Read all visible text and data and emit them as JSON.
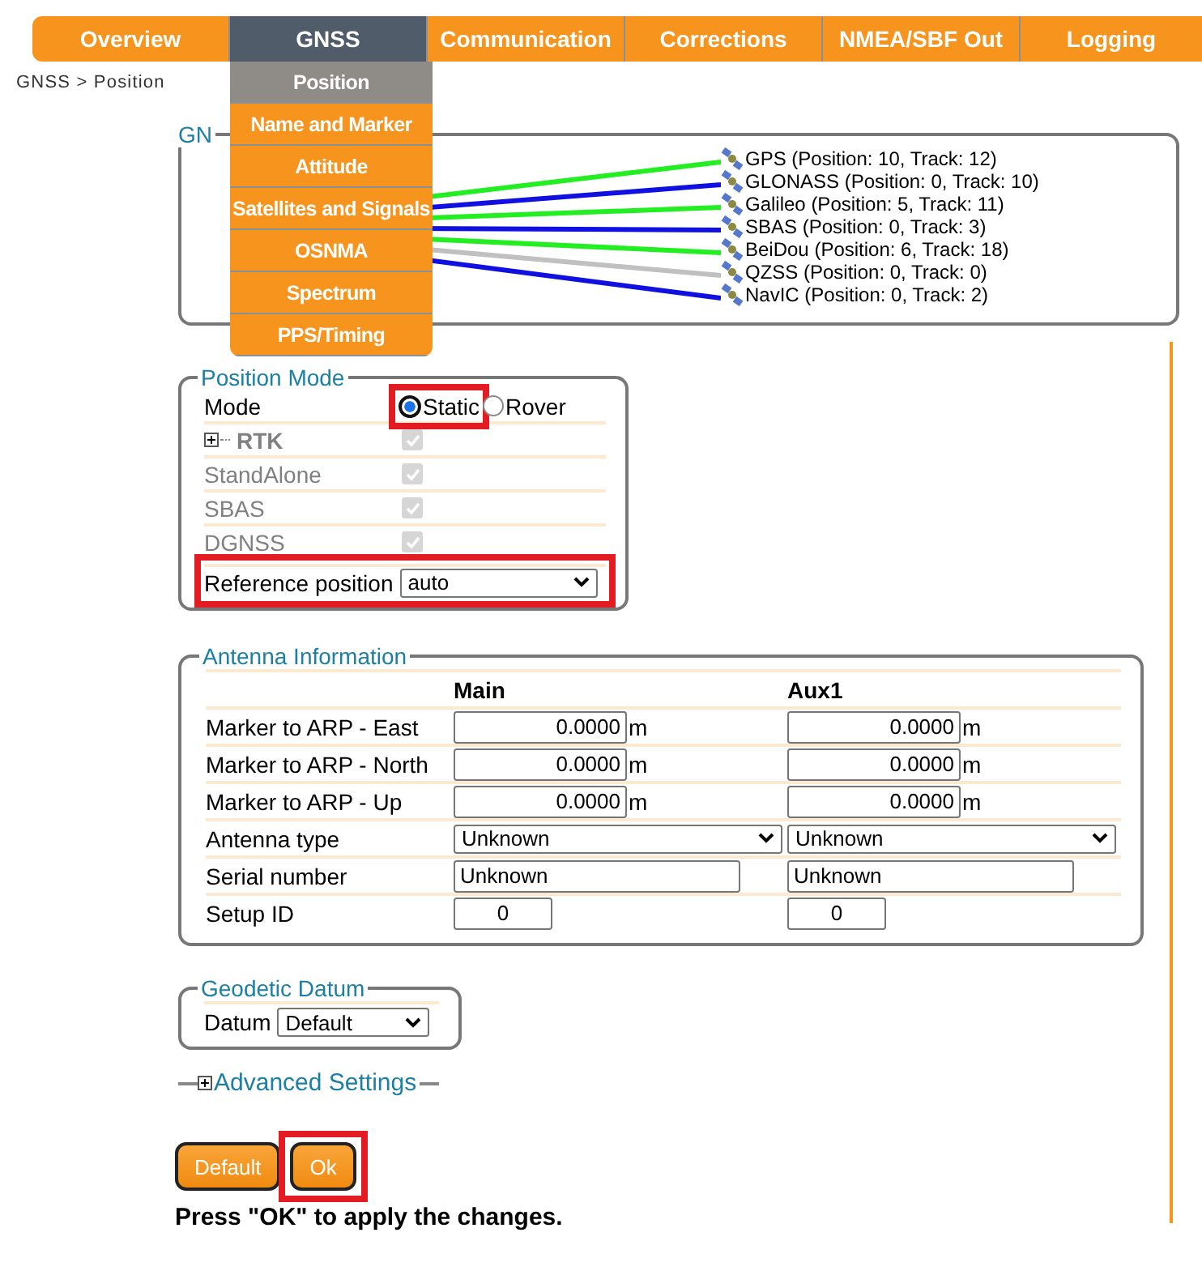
{
  "nav": {
    "tabs": [
      {
        "label": "Overview",
        "selected": false
      },
      {
        "label": "GNSS",
        "selected": true
      },
      {
        "label": "Communication",
        "selected": false
      },
      {
        "label": "Corrections",
        "selected": false
      },
      {
        "label": "NMEA/SBF Out",
        "selected": false
      },
      {
        "label": "Logging",
        "selected": false
      }
    ],
    "menu": [
      {
        "label": "Position",
        "selected": true
      },
      {
        "label": "Name and Marker",
        "selected": false
      },
      {
        "label": "Attitude",
        "selected": false
      },
      {
        "label": "Satellites and Signals",
        "selected": false
      },
      {
        "label": "OSNMA",
        "selected": false
      },
      {
        "label": "Spectrum",
        "selected": false
      },
      {
        "label": "PPS/Timing",
        "selected": false
      }
    ]
  },
  "breadcrumb": "GNSS > Position",
  "constellations": {
    "legend": "GN",
    "items": [
      {
        "label": "GPS (Position: 10, Track: 12)",
        "color": "#22ee22"
      },
      {
        "label": "GLONASS (Position: 0, Track: 10)",
        "color": "#1010e0"
      },
      {
        "label": "Galileo (Position: 5, Track: 11)",
        "color": "#22ee22"
      },
      {
        "label": "SBAS (Position: 0, Track: 3)",
        "color": "#1010e0"
      },
      {
        "label": "BeiDou (Position: 6, Track: 18)",
        "color": "#22ee22"
      },
      {
        "label": "QZSS (Position: 0, Track: 0)",
        "color": "#c0c0c0"
      },
      {
        "label": "NavIC (Position: 0, Track: 2)",
        "color": "#1010e0"
      }
    ]
  },
  "position_mode": {
    "legend": "Position Mode",
    "rows": [
      {
        "kind": "radio",
        "label": "Mode",
        "options": [
          {
            "label": "Static",
            "selected": true,
            "highlighted": true
          },
          {
            "label": "Rover",
            "selected": false,
            "highlighted": false
          }
        ]
      },
      {
        "kind": "group",
        "label": "RTK",
        "checked": true,
        "disabled": true
      },
      {
        "kind": "checkbox",
        "label": "StandAlone",
        "checked": true,
        "disabled": true
      },
      {
        "kind": "checkbox",
        "label": "SBAS",
        "checked": true,
        "disabled": true
      },
      {
        "kind": "checkbox",
        "label": "DGNSS",
        "checked": true,
        "disabled": true
      },
      {
        "kind": "select",
        "label": "Reference position",
        "value": "auto",
        "highlighted": true
      }
    ]
  },
  "antenna": {
    "legend": "Antenna Information",
    "columns": [
      "Main",
      "Aux1"
    ],
    "rows": [
      {
        "kind": "number",
        "label": "Marker to ARP - East",
        "values": [
          "0.0000",
          "0.0000"
        ],
        "units": [
          "m",
          "m"
        ]
      },
      {
        "kind": "number",
        "label": "Marker to ARP - North",
        "values": [
          "0.0000",
          "0.0000"
        ],
        "units": [
          "m",
          "m"
        ]
      },
      {
        "kind": "number",
        "label": "Marker to ARP - Up",
        "values": [
          "0.0000",
          "0.0000"
        ],
        "units": [
          "m",
          "m"
        ]
      },
      {
        "kind": "select",
        "label": "Antenna type",
        "values": [
          "Unknown",
          "Unknown"
        ]
      },
      {
        "kind": "text",
        "label": "Serial number",
        "values": [
          "Unknown",
          "Unknown"
        ]
      },
      {
        "kind": "id",
        "label": "Setup ID",
        "values": [
          "0",
          "0"
        ]
      }
    ]
  },
  "datum": {
    "legend": "Geodetic Datum",
    "label": "Datum",
    "value": "Default"
  },
  "advanced": {
    "label": "Advanced Settings",
    "expanded": false
  },
  "buttons": [
    {
      "label": "Default",
      "highlighted": false
    },
    {
      "label": "Ok",
      "highlighted": true
    }
  ],
  "note": "Press \"OK\" to apply the changes."
}
